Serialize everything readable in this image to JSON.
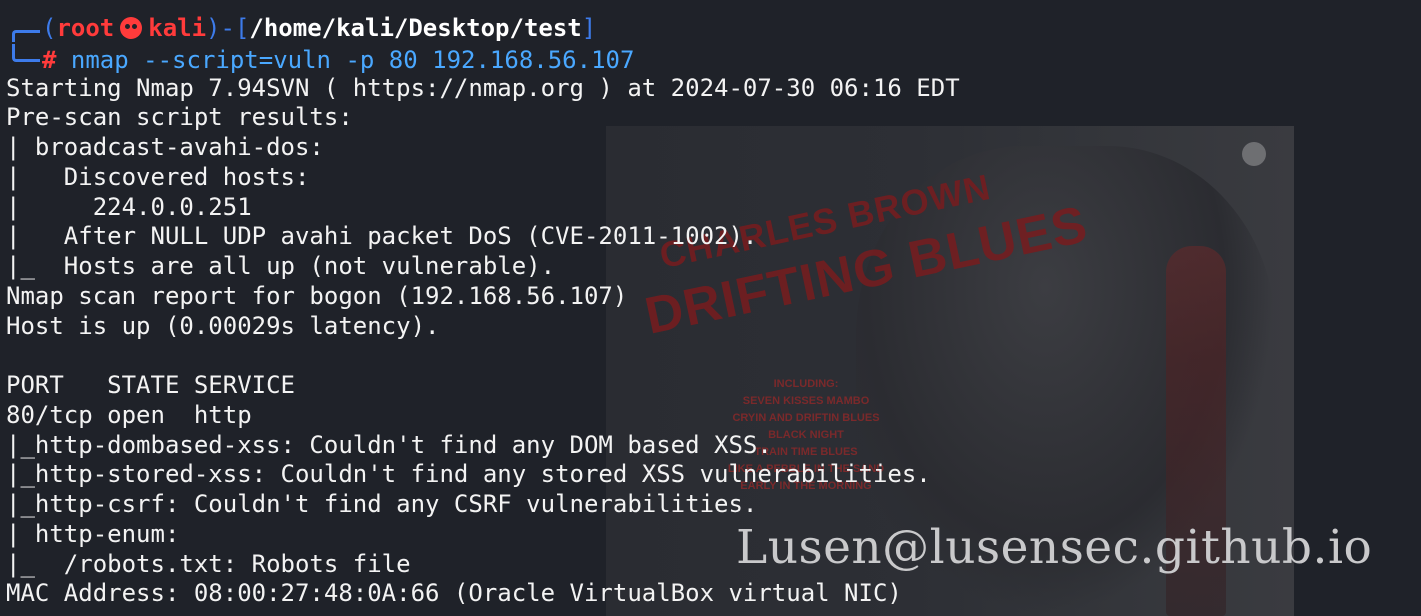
{
  "prompt": {
    "open_paren": "(",
    "user": "root",
    "host": "kali",
    "mid": ")-[",
    "path": "/home/kali/Desktop/test",
    "close_bracket": "]",
    "hash": "#",
    "command": "nmap --script=vuln -p 80 192.168.56.107"
  },
  "output_lines": [
    "Starting Nmap 7.94SVN ( https://nmap.org ) at 2024-07-30 06:16 EDT",
    "Pre-scan script results:",
    "| broadcast-avahi-dos:",
    "|   Discovered hosts:",
    "|     224.0.0.251",
    "|   After NULL UDP avahi packet DoS (CVE-2011-1002).",
    "|_  Hosts are all up (not vulnerable).",
    "Nmap scan report for bogon (192.168.56.107)",
    "Host is up (0.00029s latency).",
    "",
    "PORT   STATE SERVICE",
    "80/tcp open  http",
    "|_http-dombased-xss: Couldn't find any DOM based XSS.",
    "|_http-stored-xss: Couldn't find any stored XSS vulnerabilities.",
    "|_http-csrf: Couldn't find any CSRF vulnerabilities.",
    "| http-enum: ",
    "|_  /robots.txt: Robots file",
    "MAC Address: 08:00:27:48:0A:66 (Oracle VirtualBox virtual NIC)"
  ],
  "wallpaper": {
    "title_line1": "CHARLES BROWN",
    "title_line2": "DRIFTING BLUES",
    "tracklist": [
      "INCLUDING:",
      "SEVEN KISSES MAMBO",
      "CRYIN AND DRIFTIN BLUES",
      "BLACK NIGHT",
      "TRAIN TIME BLUES",
      "LIKE A PEBBLE IN THE SAND",
      "EARLY IN THE MORNING"
    ]
  },
  "watermark": "Lusen@lusensec.github.io",
  "colors": {
    "background": "#1f2229",
    "prompt_frame": "#3d7bea",
    "prompt_user": "#ff3b3b",
    "command": "#4aa8ff",
    "text": "#f3f3f3"
  },
  "icons": {
    "user_host_separator": "skull-icon"
  }
}
